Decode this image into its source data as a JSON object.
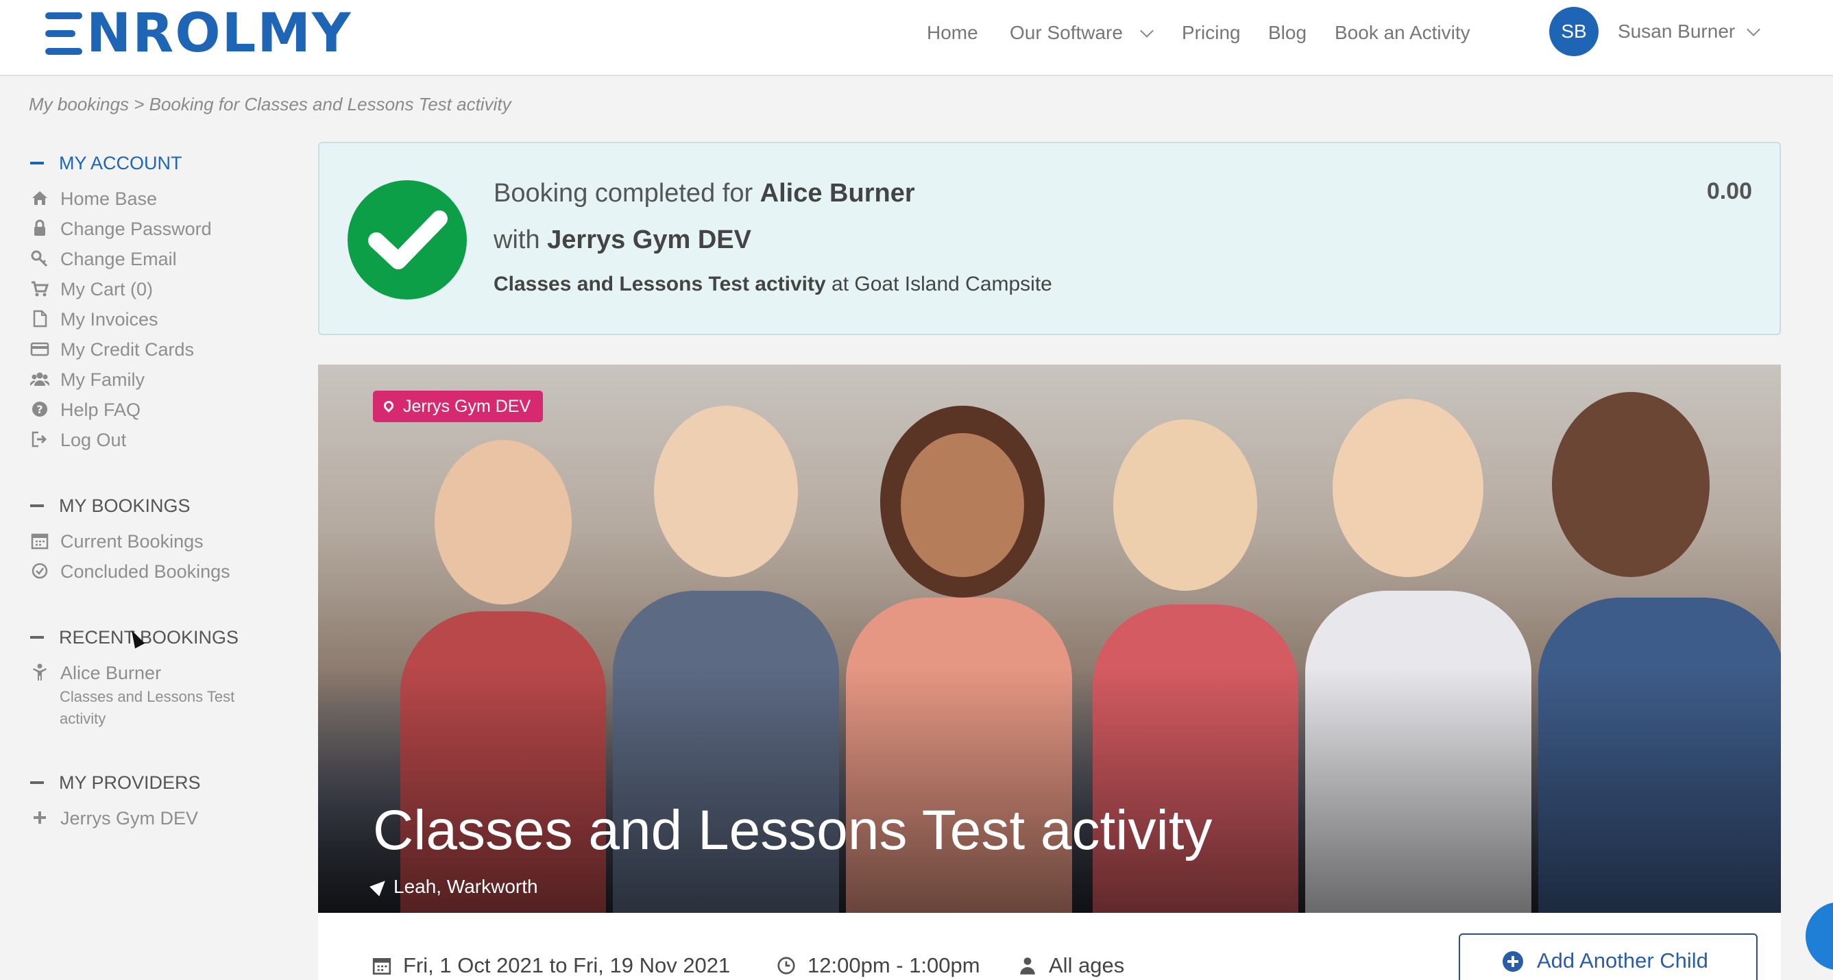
{
  "brand": {
    "name": "NROLMY",
    "color": "#1f65b5"
  },
  "nav": {
    "home": "Home",
    "software": "Our Software",
    "pricing": "Pricing",
    "blog": "Blog",
    "book": "Book an Activity"
  },
  "user": {
    "initials": "SB",
    "name": "Susan Burner"
  },
  "breadcrumb": {
    "root": "My bookings",
    "current": "> Booking for Classes and Lessons Test activity"
  },
  "sidebar": {
    "account": {
      "heading": "MY ACCOUNT",
      "items": [
        {
          "label": "Home Base",
          "icon": "home-icon"
        },
        {
          "label": "Change Password",
          "icon": "lock-icon"
        },
        {
          "label": "Change Email",
          "icon": "key-icon"
        },
        {
          "label": "My Cart (0)",
          "icon": "cart-icon"
        },
        {
          "label": "My Invoices",
          "icon": "file-icon"
        },
        {
          "label": "My Credit Cards",
          "icon": "credit-card-icon"
        },
        {
          "label": "My Family",
          "icon": "users-icon"
        },
        {
          "label": "Help FAQ",
          "icon": "question-icon"
        },
        {
          "label": "Log Out",
          "icon": "logout-icon"
        }
      ]
    },
    "bookings": {
      "heading": "MY BOOKINGS",
      "items": [
        {
          "label": "Current Bookings",
          "icon": "calendar-icon"
        },
        {
          "label": "Concluded Bookings",
          "icon": "check-circle-icon"
        }
      ]
    },
    "recent": {
      "heading": "RECENT BOOKINGS",
      "person": "Alice Burner",
      "activity": "Classes and Lessons Test activity"
    },
    "providers": {
      "heading": "MY PROVIDERS",
      "item": "Jerrys Gym DEV"
    }
  },
  "confirmation": {
    "prefix": "Booking completed for",
    "child": "Alice Burner",
    "with": "with",
    "provider": "Jerrys Gym DEV",
    "activity": "Classes and Lessons Test activity",
    "at": "at",
    "venue": "Goat Island Campsite",
    "amount": "0.00",
    "success_color": "#0d9f48"
  },
  "hero": {
    "tag": "Jerrys Gym DEV",
    "tag_color": "#d6296f",
    "title": "Classes and Lessons Test activity",
    "location": "Leah, Warkworth"
  },
  "details": {
    "dates": "Fri, 1 Oct 2021 to Fri, 19 Nov 2021",
    "time": "12:00pm - 1:00pm",
    "ages": "All ages",
    "add_child": "Add Another Child"
  }
}
